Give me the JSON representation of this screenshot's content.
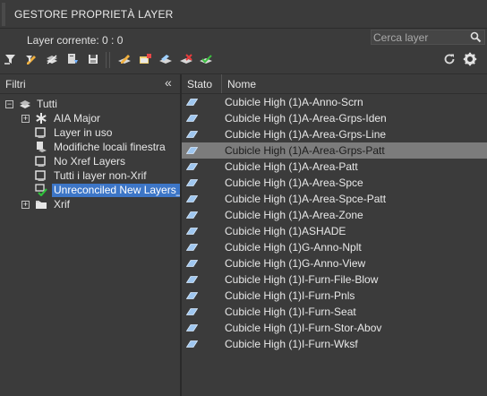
{
  "title": "GESTORE PROPRIETÀ LAYER",
  "current_layer": "Layer corrente: 0 : 0",
  "search": {
    "placeholder": "Cerca layer"
  },
  "toolbar": {
    "left_icons": [
      "new-property-filter-icon",
      "new-group-filter-icon",
      "layer-states-manager-icon",
      "layer-states-save-icon",
      "layer-states-restore-icon"
    ],
    "right_icons": [
      "new-layer-icon",
      "new-vp-frozen-layer-icon",
      "delete-layer-icon",
      "set-current-layer-icon",
      "refresh-layer-icon"
    ],
    "refresh_icon": "refresh-icon",
    "settings_icon": "gear-icon"
  },
  "filters": {
    "header": "Filtri",
    "collapse_glyph": "«",
    "root": "Tutti",
    "items": [
      {
        "label": "AIA Major",
        "icon": "asterisk-filter-icon",
        "expandable": true
      },
      {
        "label": "Layer in uso",
        "icon": "filter-icon",
        "expandable": false
      },
      {
        "label": "Modifiche locali finestra",
        "icon": "viewport-filter-icon",
        "expandable": false
      },
      {
        "label": "No Xref Layers",
        "icon": "filter-icon",
        "expandable": false
      },
      {
        "label": "Tutti i layer non-Xrif",
        "icon": "filter-icon",
        "expandable": false
      },
      {
        "label": "Unreconciled New Layers_",
        "icon": "unreconciled-check-icon",
        "expandable": false,
        "selected": true
      },
      {
        "label": "Xrif",
        "icon": "xref-folder-icon",
        "expandable": true
      }
    ]
  },
  "list": {
    "columns": [
      "Stato",
      "Nome"
    ],
    "rows": [
      {
        "name": "Cubicle High (1)A-Anno-Scrn"
      },
      {
        "name": "Cubicle High (1)A-Area-Grps-Iden"
      },
      {
        "name": "Cubicle High (1)A-Area-Grps-Line"
      },
      {
        "name": "Cubicle High (1)A-Area-Grps-Patt",
        "selected": true
      },
      {
        "name": "Cubicle High (1)A-Area-Patt"
      },
      {
        "name": "Cubicle High (1)A-Area-Spce"
      },
      {
        "name": "Cubicle High (1)A-Area-Spce-Patt"
      },
      {
        "name": "Cubicle High (1)A-Area-Zone"
      },
      {
        "name": "Cubicle High (1)ASHADE"
      },
      {
        "name": "Cubicle High (1)G-Anno-Nplt"
      },
      {
        "name": "Cubicle High (1)G-Anno-View"
      },
      {
        "name": "Cubicle High (1)I-Furn-File-Blow"
      },
      {
        "name": "Cubicle High (1)I-Furn-Pnls"
      },
      {
        "name": "Cubicle High (1)I-Furn-Seat"
      },
      {
        "name": "Cubicle High (1)I-Furn-Stor-Abov"
      },
      {
        "name": "Cubicle High (1)I-Furn-Wksf"
      }
    ]
  },
  "colors": {
    "background": "#3b3b3b",
    "selection_blue": "#3d76c7",
    "row_selected": "#7c7c7c",
    "layer_icon": "#9fc7f0"
  }
}
